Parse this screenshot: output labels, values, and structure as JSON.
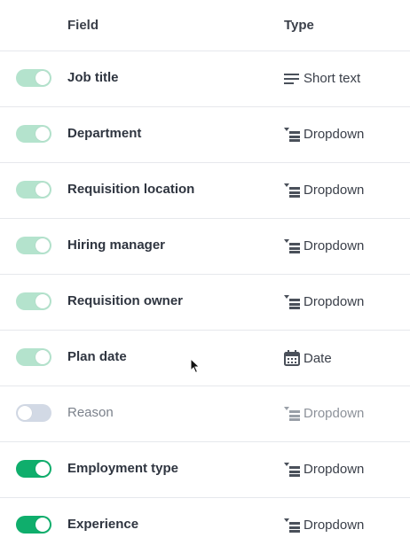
{
  "header": {
    "field": "Field",
    "type": "Type"
  },
  "rows": [
    {
      "label": "Job title",
      "type": "Short text",
      "icon": "short-text-icon",
      "toggle": "on-light"
    },
    {
      "label": "Department",
      "type": "Dropdown",
      "icon": "dropdown-icon",
      "toggle": "on-light"
    },
    {
      "label": "Requisition location",
      "type": "Dropdown",
      "icon": "dropdown-icon",
      "toggle": "on-light"
    },
    {
      "label": "Hiring manager",
      "type": "Dropdown",
      "icon": "dropdown-icon",
      "toggle": "on-light"
    },
    {
      "label": "Requisition owner",
      "type": "Dropdown",
      "icon": "dropdown-icon",
      "toggle": "on-light"
    },
    {
      "label": "Plan date",
      "type": "Date",
      "icon": "calendar-icon",
      "toggle": "on-light"
    },
    {
      "label": "Reason",
      "type": "Dropdown",
      "icon": "dropdown-icon",
      "toggle": "off"
    },
    {
      "label": "Employment type",
      "type": "Dropdown",
      "icon": "dropdown-icon",
      "toggle": "on-strong"
    },
    {
      "label": "Experience",
      "type": "Dropdown",
      "icon": "dropdown-icon",
      "toggle": "on-strong"
    }
  ],
  "colors": {
    "toggle_on_light": "#b4e3cd",
    "toggle_on_strong": "#0fae6c",
    "toggle_off": "#d2d9e5"
  }
}
